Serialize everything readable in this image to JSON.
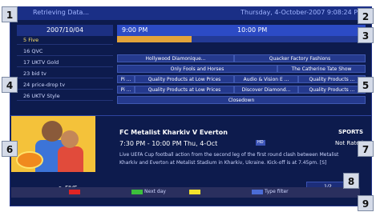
{
  "status": {
    "left": "Retrieving Data...",
    "right": "Thursday, 4-October-2007  9:08:24 PM"
  },
  "guide": {
    "date": "2007/10/04",
    "times": [
      "9:00 PM",
      "10:00 PM"
    ],
    "channels": [
      "5 Five",
      "16 QVC",
      "17 UKTV Gold",
      "23 bid tv",
      "24 price-drop tv",
      "26 UKTV Style"
    ],
    "selected_channel_index": 0,
    "rows": [
      [
        "",
        ""
      ],
      [
        "Hollywood Diamonique...",
        "Quacker Factory Fashions"
      ],
      [
        "Only Fools and Horses",
        "The Catherine Tate Show"
      ],
      [
        "Pi ...",
        "Quality Products at Low Prices",
        "Audio & Vision E ...",
        "Quality Products ..."
      ],
      [
        "Pi ...",
        "Quality Products at Low Prices",
        "Discover Diamond...",
        "Quality Products ..."
      ],
      [
        "Closedown"
      ]
    ],
    "progress_fraction": 0.3
  },
  "info": {
    "title": "FC Metalist Kharkiv V Everton",
    "time": "7:30 PM - 10:00 PM  Thu, 4-Oct",
    "tag": "HD",
    "genre": "SPORTS",
    "rating": "Not Rated",
    "description": "Live UEFA Cup football action from the second leg of the first round clash between Metalist Kharkiv and Everton at Metalist Stadium in Kharkiv, Ukraine. Kick-off is at 7.45pm. [S]"
  },
  "footer": {
    "channel": "> FIVE",
    "page": "1/2"
  },
  "keys": [
    {
      "color": "#e02424",
      "label": ""
    },
    {
      "color": "#3cbf3c",
      "label": "Next day"
    },
    {
      "color": "#f2e22c",
      "label": ""
    },
    {
      "color": "#4b6cd6",
      "label": "Type filter"
    }
  ],
  "callouts": [
    "1",
    "2",
    "3",
    "4",
    "5",
    "6",
    "7",
    "8",
    "9"
  ]
}
